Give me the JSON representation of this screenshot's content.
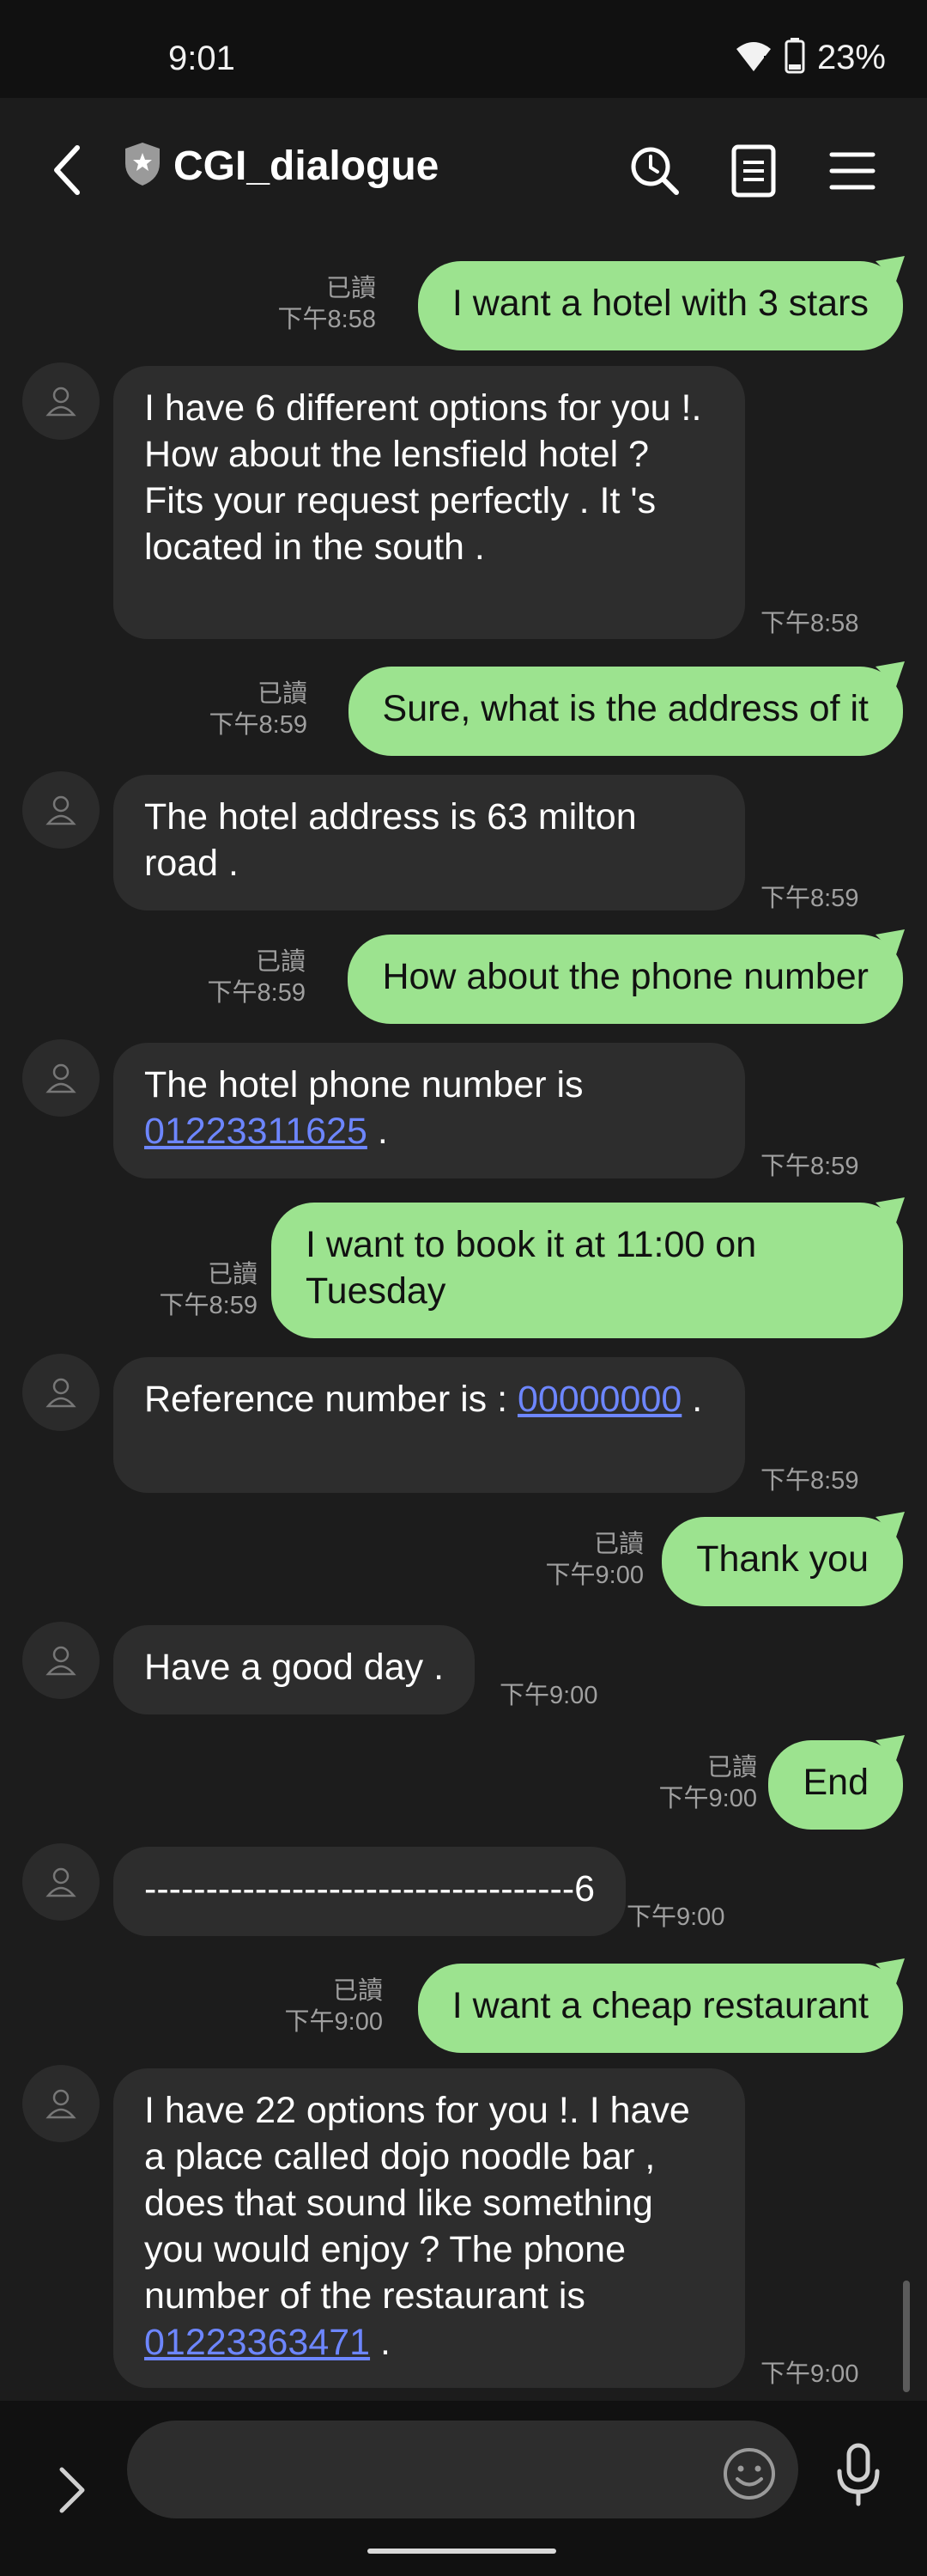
{
  "status_bar": {
    "time": "9:01",
    "battery": "23%"
  },
  "header": {
    "title": "CGI_dialogue",
    "icons": [
      "back-icon",
      "verified-shield-icon",
      "search-history-icon",
      "notes-icon",
      "menu-icon"
    ]
  },
  "messages": [
    {
      "side": "out",
      "text": "I want a hotel with 3 stars",
      "read": "已讀",
      "time": "下午8:58"
    },
    {
      "side": "in",
      "text": "I have 6 different options for you !. How about the lensfield hotel ? Fits your request perfectly . It 's located in the south .",
      "time": "下午8:58"
    },
    {
      "side": "out",
      "text": "Sure, what is the address of it",
      "read": "已讀",
      "time": "下午8:59"
    },
    {
      "side": "in",
      "text": "The hotel address is 63 milton road .",
      "time": "下午8:59"
    },
    {
      "side": "out",
      "text": "How about the phone number",
      "read": "已讀",
      "time": "下午8:59"
    },
    {
      "side": "in",
      "text_before": "The hotel phone number is ",
      "link": "01223311625",
      "text_after": " .",
      "time": "下午8:59"
    },
    {
      "side": "out",
      "text": "I want to book it at 11:00 on Tuesday",
      "read": "已讀",
      "time": "下午8:59"
    },
    {
      "side": "in",
      "text_before": "Reference number is : ",
      "link": "00000000",
      "text_after": " .",
      "time": "下午8:59"
    },
    {
      "side": "out",
      "text": "Thank you",
      "read": "已讀",
      "time": "下午9:00"
    },
    {
      "side": "in",
      "text": "Have a good day .",
      "time": "下午9:00"
    },
    {
      "side": "out",
      "text": "End",
      "read": "已讀",
      "time": "下午9:00"
    },
    {
      "side": "in",
      "text": "-----------------------------------6",
      "time": "下午9:00"
    },
    {
      "side": "out",
      "text": "I want a cheap restaurant",
      "read": "已讀",
      "time": "下午9:00"
    },
    {
      "side": "in",
      "text_before": "I have 22 options for you !. I have a place called dojo noodle bar , does that sound like something you would enjoy ? The phone number of the restaurant is ",
      "link": "01223363471",
      "text_after": " .",
      "time": "下午9:00"
    }
  ],
  "input": {
    "value": "",
    "placeholder": ""
  },
  "colors": {
    "background": "#1c1c1c",
    "outgoing_bubble": "#9ce38f",
    "incoming_bubble": "#2d2d2d",
    "link": "#6d86ff",
    "timestamp": "#a0a0a0"
  }
}
